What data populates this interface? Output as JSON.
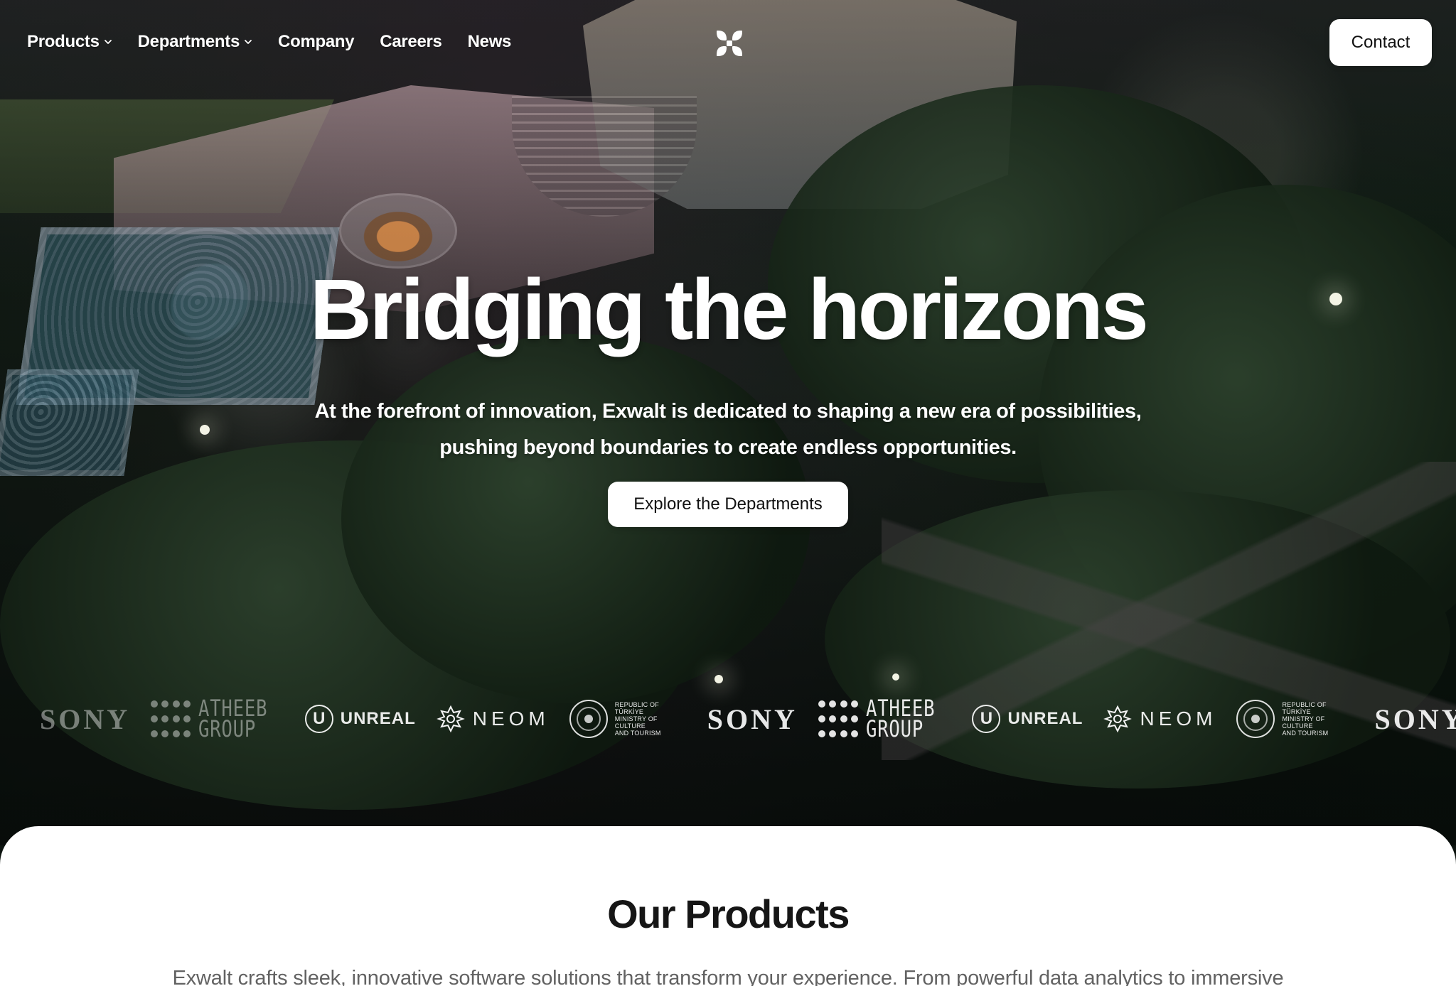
{
  "nav": {
    "items": [
      {
        "label": "Products",
        "has_dropdown": true
      },
      {
        "label": "Departments",
        "has_dropdown": true
      },
      {
        "label": "Company",
        "has_dropdown": false
      },
      {
        "label": "Careers",
        "has_dropdown": false
      },
      {
        "label": "News",
        "has_dropdown": false
      }
    ],
    "logo_icon": "four-petal-logo-icon",
    "contact_label": "Contact"
  },
  "hero": {
    "title": "Bridging the horizons",
    "subtitle_line1": "At the forefront of innovation, Exwalt is dedicated to shaping a new era of possibilities,",
    "subtitle_line2": "pushing beyond boundaries to create endless opportunities.",
    "cta_label": "Explore the Departments"
  },
  "partners": {
    "sony": "SONY",
    "atheeb_main": "ATHEEB",
    "atheeb_sub": "GROUP",
    "unreal_mark": "U",
    "unreal": "UNREAL",
    "neom": "NEOM",
    "ministry_line1": "REPUBLIC OF TÜRKİYE",
    "ministry_line2": "MINISTRY OF CULTURE",
    "ministry_line3": "AND TOURISM"
  },
  "products": {
    "title": "Our Products",
    "description": "Exwalt crafts sleek, innovative software solutions that transform your experience. From powerful data analytics to immersive"
  },
  "colors": {
    "white": "#ffffff",
    "text_dark": "#161616",
    "text_muted": "#626262"
  }
}
